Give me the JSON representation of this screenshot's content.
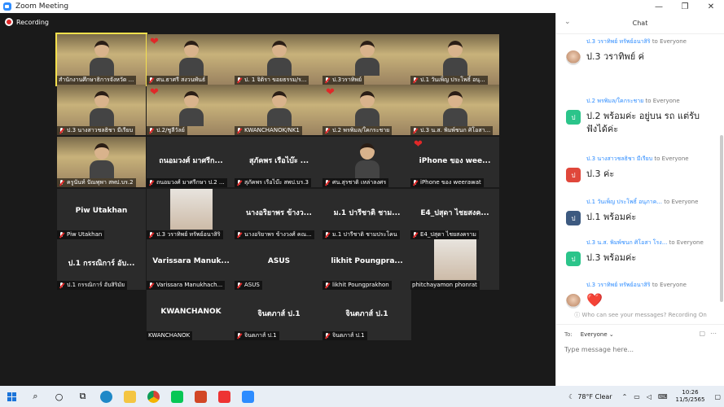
{
  "window": {
    "title": "Zoom Meeting",
    "controls": [
      "—",
      "❐",
      "✕"
    ]
  },
  "recording_label": "Recording",
  "tiles": [
    {
      "row": 0,
      "col": 0,
      "label": "สำนักงานศึกษาธิการจังหวัด ...",
      "kind": "video",
      "active": true,
      "heart": false,
      "mic_off": false
    },
    {
      "row": 0,
      "col": 1,
      "label": "ศน.ธาศรี สงวนพันธ์",
      "kind": "video",
      "heart": true,
      "mic_off": true
    },
    {
      "row": 0,
      "col": 2,
      "label": "ป. 1 จิติรา ขอยธรรม/ร...",
      "kind": "video",
      "heart": false,
      "mic_off": true
    },
    {
      "row": 0,
      "col": 3,
      "label": "ป.3วราทิพย์",
      "kind": "video",
      "heart": false,
      "mic_off": true
    },
    {
      "row": 0,
      "col": 4,
      "label": "ป.1 วันเพ็ญ ประโพธิ์ อนุ...",
      "kind": "video",
      "heart": false,
      "mic_off": true
    },
    {
      "row": 1,
      "col": 0,
      "label": "ป.3 นางสาวชลธิชา มีเรียบ",
      "kind": "video",
      "heart": false,
      "mic_off": true
    },
    {
      "row": 1,
      "col": 1,
      "label": "ป.2/ชูลีวัลย์",
      "kind": "video",
      "heart": true,
      "mic_off": true
    },
    {
      "row": 1,
      "col": 2,
      "label": "KWANCHANOK/NK1",
      "kind": "video",
      "heart": false,
      "mic_off": true
    },
    {
      "row": 1,
      "col": 3,
      "label": "ป.2 พรพิมล/ใคกระชาย",
      "kind": "video",
      "heart": true,
      "mic_off": true
    },
    {
      "row": 1,
      "col": 4,
      "label": "ป.3 น.ส. พิมพ์ชนก ศิโอสา...",
      "kind": "video",
      "heart": false,
      "mic_off": true
    },
    {
      "row": 2,
      "col": 0,
      "label": "ครูนันท์ ปัณพุพา สพป.บร.2",
      "kind": "video",
      "heart": false,
      "mic_off": true
    },
    {
      "row": 2,
      "col": 1,
      "big": "ถนอมวงศ์ มาศรีก...",
      "label": "ถนอมวงศ์ มาศรีกษา ป.2 ...",
      "kind": "name",
      "heart": false,
      "mic_off": true
    },
    {
      "row": 2,
      "col": 2,
      "big": "สุภัคพร เรือไบ๊ะ ...",
      "label": "สุภัคพร เรือไบ๊ะ สพป.บร.3",
      "kind": "name",
      "heart": false,
      "mic_off": true
    },
    {
      "row": 2,
      "col": 3,
      "label": "ศน.สุรชาติ เหล่าลงศร",
      "kind": "video-dark",
      "heart": false,
      "mic_off": true
    },
    {
      "row": 2,
      "col": 4,
      "big": "iPhone ของ wee...",
      "label": "iPhone ของ weerawat",
      "kind": "name",
      "heart": true,
      "mic_off": true
    },
    {
      "row": 3,
      "col": 0,
      "big": "Piw Utakhan",
      "label": "Piw Utakhan",
      "kind": "name",
      "heart": false,
      "mic_off": true
    },
    {
      "row": 3,
      "col": 1,
      "label": "ป.3 วราทิพย์ ทรัพย์อนาสิริ",
      "kind": "thumb",
      "heart": false,
      "mic_off": true
    },
    {
      "row": 3,
      "col": 2,
      "big": "นางอริยาพร ข้างว...",
      "label": "นางอริยาพร ข้างวงศ์ คณ...",
      "kind": "name",
      "heart": false,
      "mic_off": true
    },
    {
      "row": 3,
      "col": 3,
      "big": "ม.1 ปารีชาติ ชาม...",
      "label": "ม.1 ปารีชาติ ชามประโคน",
      "kind": "name",
      "heart": false,
      "mic_off": true
    },
    {
      "row": 3,
      "col": 4,
      "big": "E4_ปสุดา ไชยสงค...",
      "label": "E4_ปสุดา ไชยสงคราม",
      "kind": "name",
      "heart": false,
      "mic_off": true
    },
    {
      "row": 4,
      "col": 0,
      "big": "ป.1 กรรณิการ์ อับ...",
      "label": "ป.1 กรรณิการ์ อับสิริมัย",
      "kind": "name",
      "heart": false,
      "mic_off": true
    },
    {
      "row": 4,
      "col": 1,
      "big": "Varissara Manuk...",
      "label": "Varissara Manukhach...",
      "kind": "name",
      "heart": false,
      "mic_off": true
    },
    {
      "row": 4,
      "col": 2,
      "big": "ASUS",
      "label": "ASUS",
      "kind": "name",
      "heart": false,
      "mic_off": true
    },
    {
      "row": 4,
      "col": 3,
      "big": "likhit Poungpra...",
      "label": "likhit Poungprakhon",
      "kind": "name",
      "heart": false,
      "mic_off": true
    },
    {
      "row": 4,
      "col": 4,
      "label": "phitchayamon phonrat",
      "kind": "thumb",
      "heart": false,
      "mic_off": false
    },
    {
      "row": 5,
      "col": 1,
      "big": "KWANCHANOK",
      "label": "KWANCHANOK",
      "kind": "name",
      "heart": false,
      "mic_off": false
    },
    {
      "row": 5,
      "col": 2,
      "big": "จินตภาส์ ป.1",
      "label": "จินตภาส์ ป.1",
      "kind": "name",
      "heart": false,
      "mic_off": true
    },
    {
      "row": 5,
      "col": 3,
      "big": "จินตภาส์ ป.1",
      "label": "จินตภาส์ ป.1",
      "kind": "name",
      "heart": false,
      "mic_off": true
    }
  ],
  "chat": {
    "title": "Chat",
    "to_word": "to Everyone",
    "messages": [
      {
        "from": "ป.3 วราทิพย์ ทรัพย์อนาสิริ",
        "avatar": "photo",
        "avatar_color": "",
        "text": "ป.3 วราทิพย์ ค่"
      },
      {
        "from": "ป.2 พรพิมล/ใคกระชาย",
        "avatar": "ป",
        "avatar_color": "#2bc48a",
        "text": "ป.2 พร้อมค่ะ อยู่บน รถ แต่รับฟังได้ค่ะ"
      },
      {
        "from": "ป.3 นางสาวชลธิชา มีเรียบ",
        "avatar": "ป",
        "avatar_color": "#e0473b",
        "text": "ป.3 ค่ะ"
      },
      {
        "from": "ป.1 วันเพ็ญ ประโพธิ์ อนุภาค...",
        "avatar": "ป",
        "avatar_color": "#3d5a80",
        "text": "ป.1 พร้อมค่ะ"
      },
      {
        "from": "ป.3 น.ส. พิมพ์ชนก ศิโอสา โรง...",
        "avatar": "ป",
        "avatar_color": "#2bc48a",
        "text": "ป.3 พร้อมค่ะ"
      },
      {
        "from": "ป.3 วราทิพย์ ทรัพย์อนาสิริ",
        "avatar": "photo",
        "avatar_color": "",
        "text": "❤️"
      }
    ],
    "visibility_note": "Who can see your messages? Recording On",
    "to_label": "To:",
    "to_value": "Everyone",
    "placeholder": "Type message here..."
  },
  "taskbar": {
    "weather": "78°F  Clear",
    "time": "10:26",
    "date": "11/5/2565"
  }
}
